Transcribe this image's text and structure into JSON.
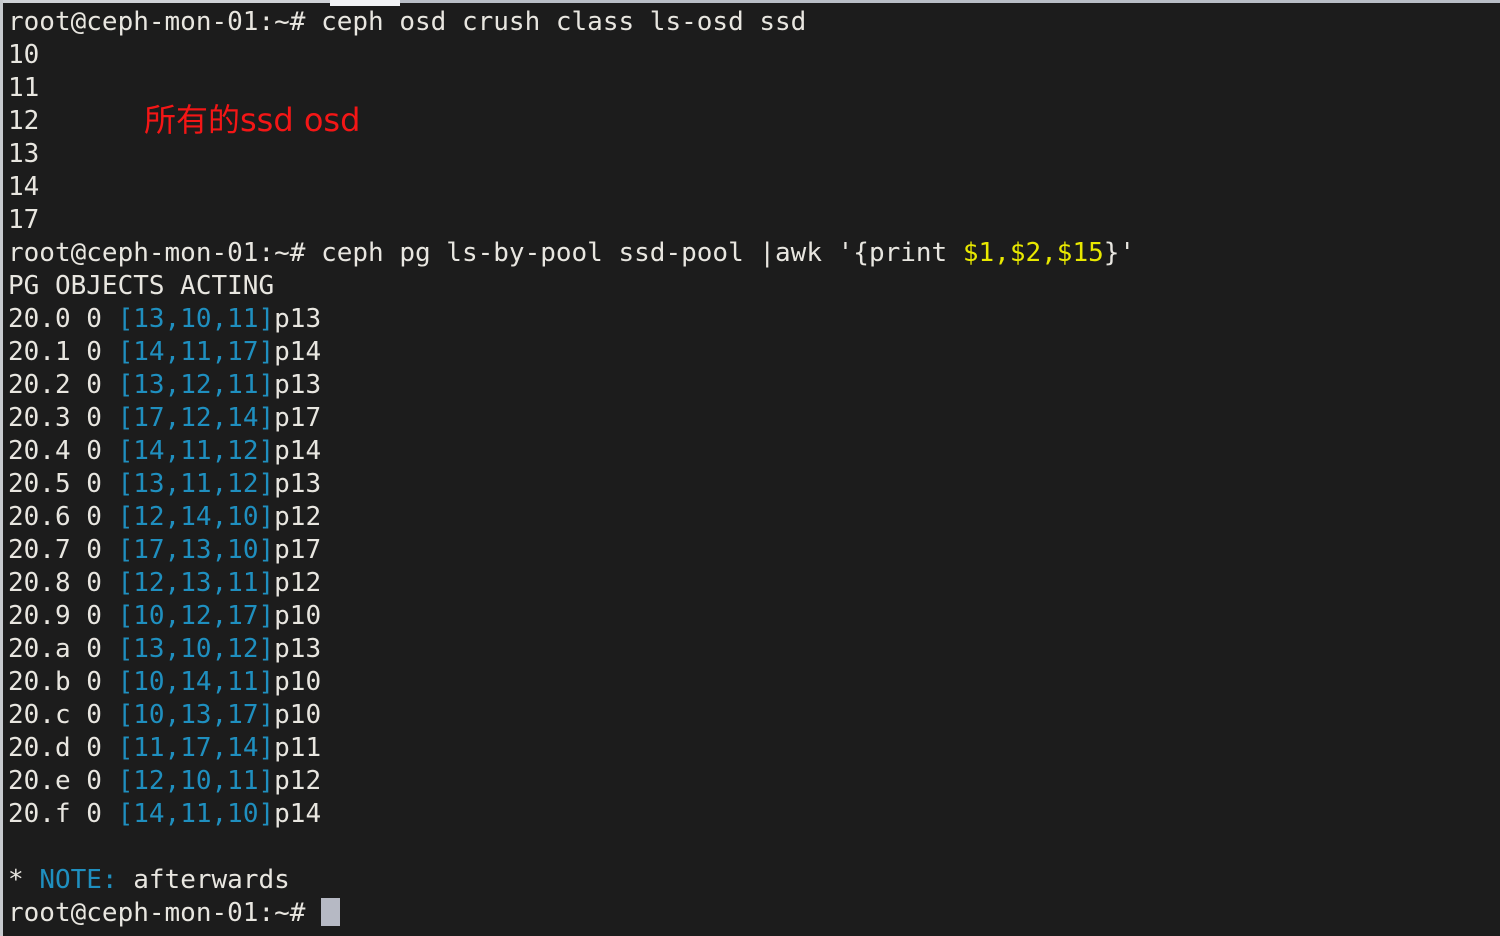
{
  "terminal": {
    "prompt": "root@ceph-mon-01:~# ",
    "command_1": "ceph osd crush class ls-osd ssd",
    "osd_ids": [
      "10",
      "11",
      "12",
      "13",
      "14",
      "17"
    ],
    "annotation": "所有的ssd osd",
    "command_2_pre": "ceph pg ls-by-pool ssd-pool |awk '{print ",
    "command_2_vars": "$1,$2,$15",
    "command_2_post": "}'",
    "table_header": "PG OBJECTS ACTING",
    "rows": [
      {
        "pg": "20.0",
        "objects": "0",
        "acting": "[13,10,11]",
        "primary": "p13"
      },
      {
        "pg": "20.1",
        "objects": "0",
        "acting": "[14,11,17]",
        "primary": "p14"
      },
      {
        "pg": "20.2",
        "objects": "0",
        "acting": "[13,12,11]",
        "primary": "p13"
      },
      {
        "pg": "20.3",
        "objects": "0",
        "acting": "[17,12,14]",
        "primary": "p17"
      },
      {
        "pg": "20.4",
        "objects": "0",
        "acting": "[14,11,12]",
        "primary": "p14"
      },
      {
        "pg": "20.5",
        "objects": "0",
        "acting": "[13,11,12]",
        "primary": "p13"
      },
      {
        "pg": "20.6",
        "objects": "0",
        "acting": "[12,14,10]",
        "primary": "p12"
      },
      {
        "pg": "20.7",
        "objects": "0",
        "acting": "[17,13,10]",
        "primary": "p17"
      },
      {
        "pg": "20.8",
        "objects": "0",
        "acting": "[12,13,11]",
        "primary": "p12"
      },
      {
        "pg": "20.9",
        "objects": "0",
        "acting": "[10,12,17]",
        "primary": "p10"
      },
      {
        "pg": "20.a",
        "objects": "0",
        "acting": "[13,10,12]",
        "primary": "p13"
      },
      {
        "pg": "20.b",
        "objects": "0",
        "acting": "[10,14,11]",
        "primary": "p10"
      },
      {
        "pg": "20.c",
        "objects": "0",
        "acting": "[10,13,17]",
        "primary": "p10"
      },
      {
        "pg": "20.d",
        "objects": "0",
        "acting": "[11,17,14]",
        "primary": "p11"
      },
      {
        "pg": "20.e",
        "objects": "0",
        "acting": "[12,10,11]",
        "primary": "p12"
      },
      {
        "pg": "20.f",
        "objects": "0",
        "acting": "[14,11,10]",
        "primary": "p14"
      }
    ],
    "note_marker": "* ",
    "note_label": "NOTE:",
    "note_text": " afterwards"
  },
  "colors": {
    "background": "#1c1c1c",
    "foreground": "#e8e6e0",
    "cyan": "#1f8fbf",
    "yellow": "#e8e800",
    "annotation_red": "#f41616",
    "cursor": "#b6b9c4"
  }
}
